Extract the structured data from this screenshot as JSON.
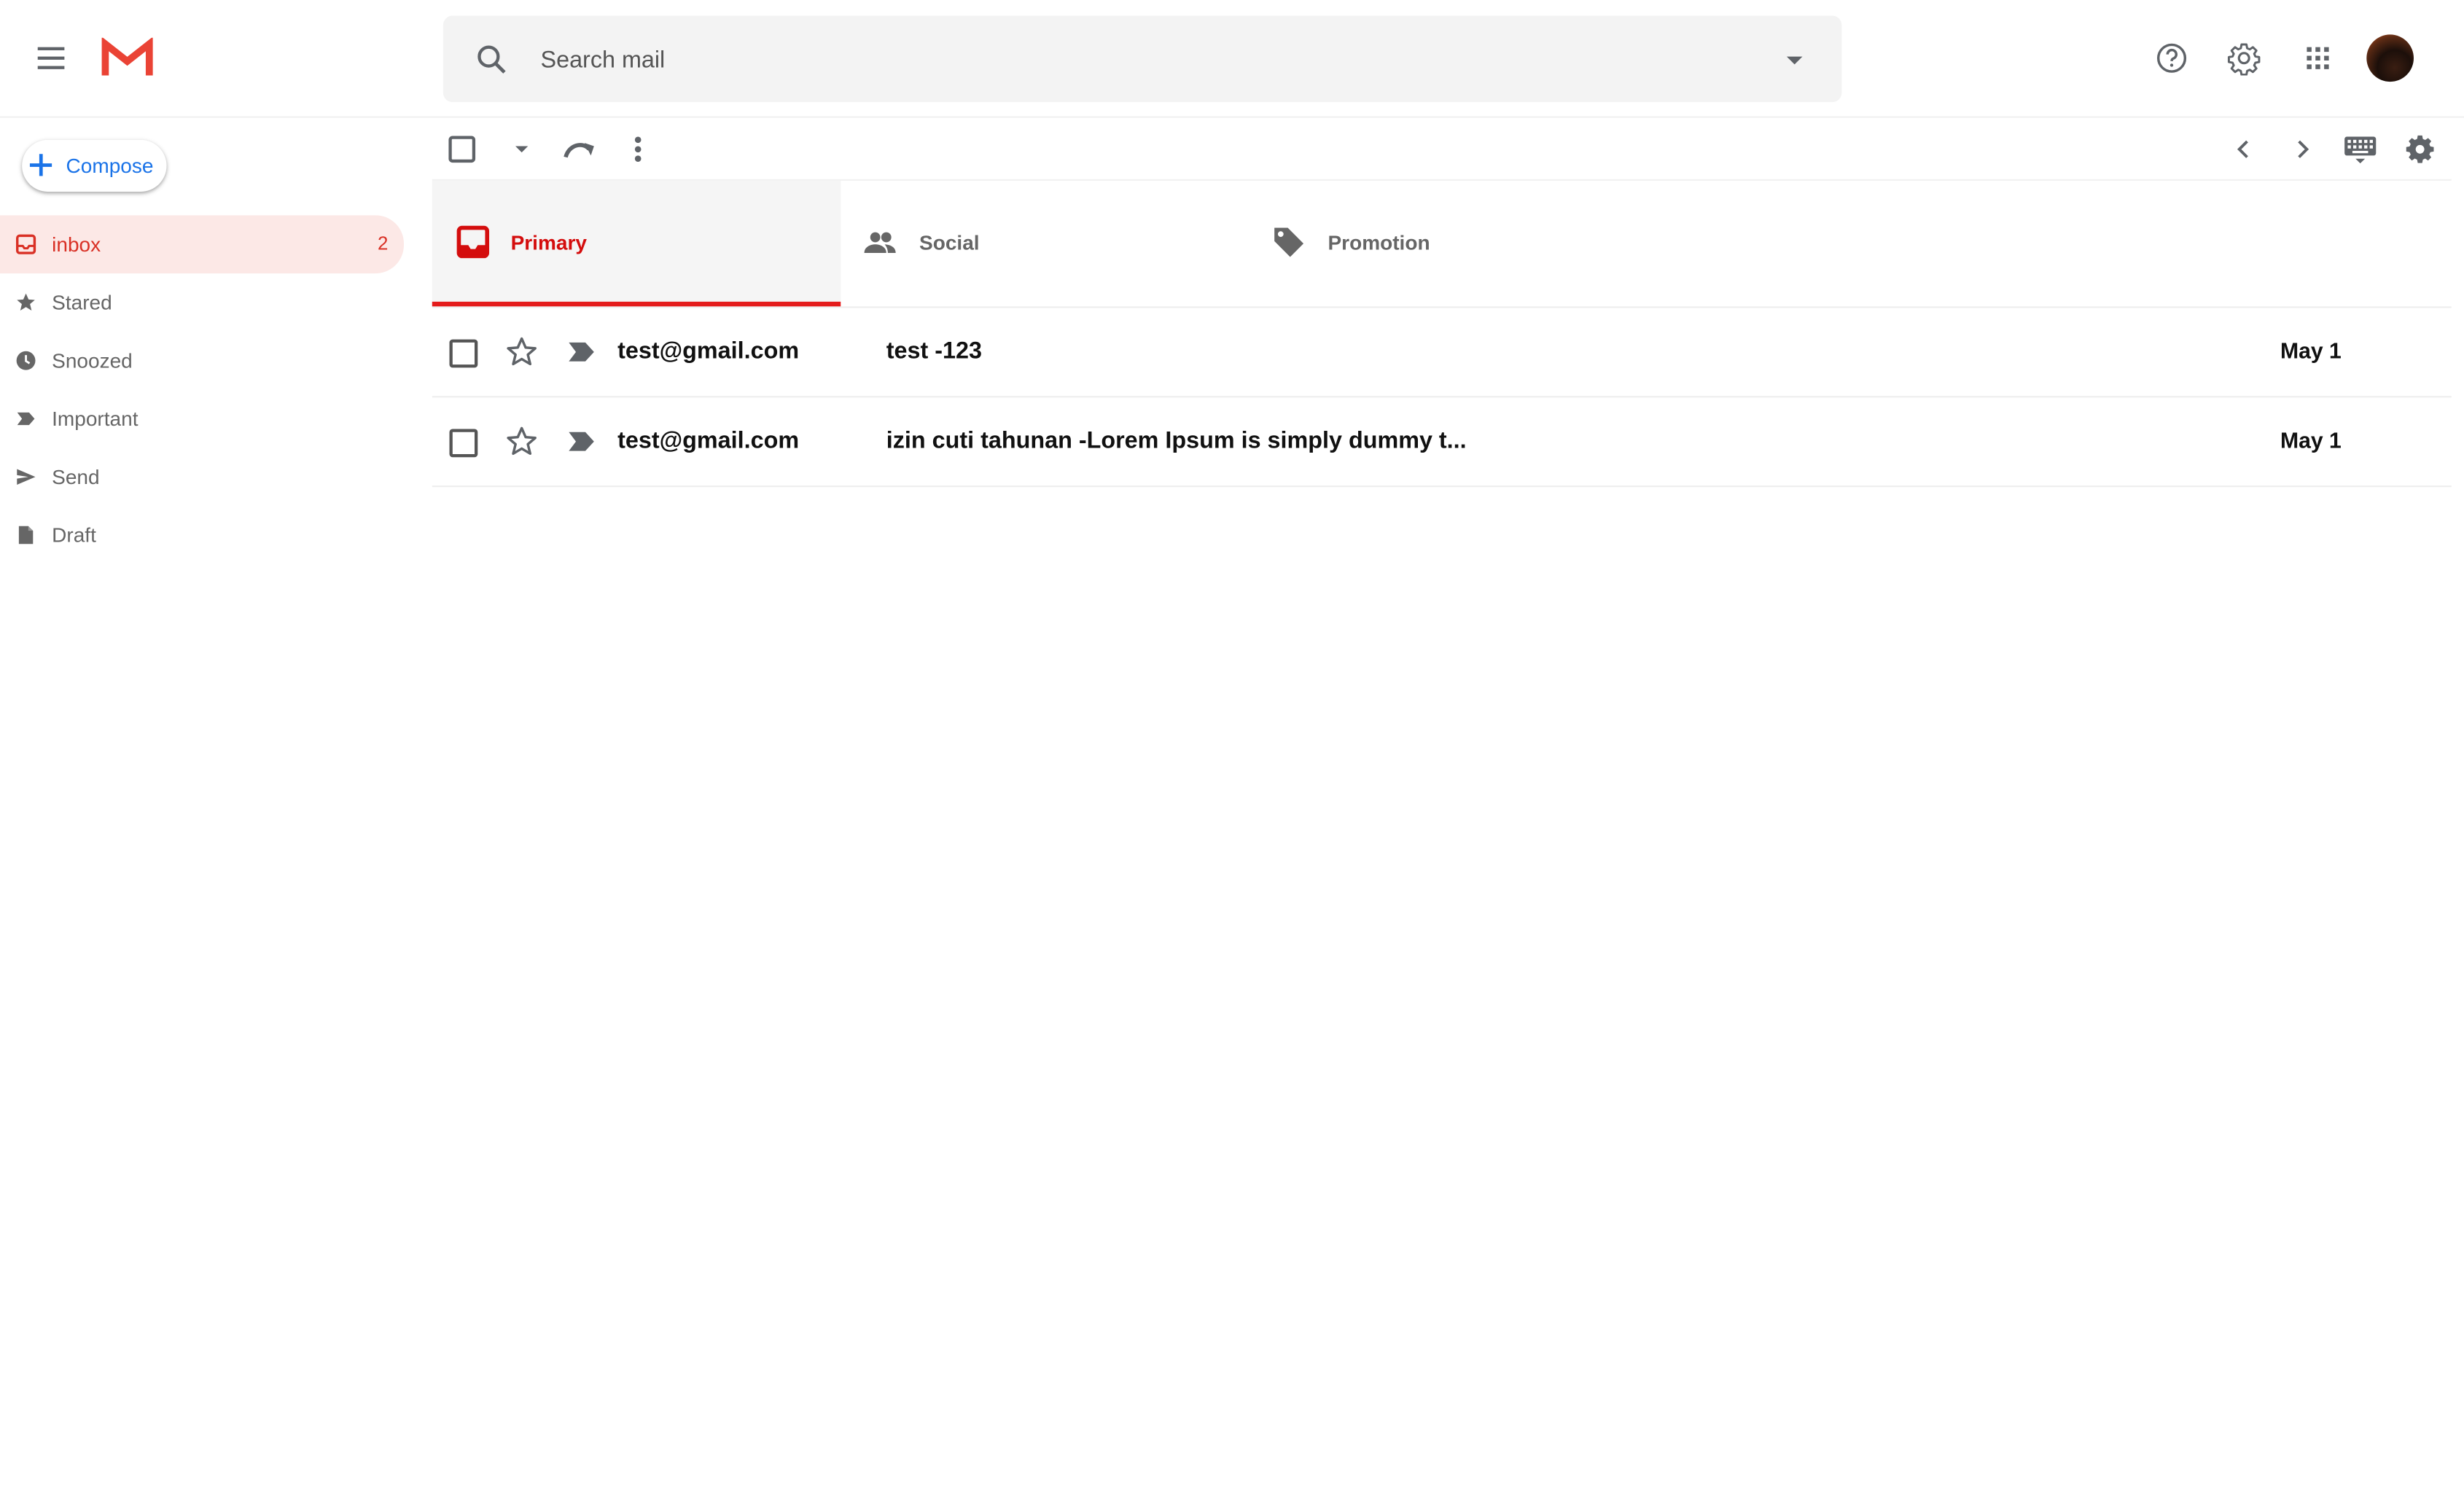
{
  "header": {
    "search_placeholder": "Search mail",
    "icons": [
      "menu-icon",
      "gmail-logo",
      "search-icon",
      "search-options-icon",
      "help-icon",
      "settings-icon",
      "apps-icon",
      "avatar"
    ]
  },
  "sidebar": {
    "compose_label": "Compose",
    "items": [
      {
        "label": "inbox",
        "icon": "inbox-icon",
        "count": "2",
        "active": true
      },
      {
        "label": "Stared",
        "icon": "star-icon"
      },
      {
        "label": "Snoozed",
        "icon": "clock-icon"
      },
      {
        "label": "Important",
        "icon": "important-icon"
      },
      {
        "label": "Send",
        "icon": "send-icon"
      },
      {
        "label": "Draft",
        "icon": "draft-icon"
      }
    ]
  },
  "toolbar": {
    "icons": [
      "select-all-checkbox",
      "select-dropdown-icon",
      "refresh-icon",
      "more-icon",
      "prev-page-icon",
      "next-page-icon",
      "keyboard-icon",
      "settings-icon"
    ]
  },
  "tabs": [
    {
      "label": "Primary",
      "icon": "inbox-icon",
      "active": true
    },
    {
      "label": "Social",
      "icon": "people-icon"
    },
    {
      "label": "Promotion",
      "icon": "tag-icon"
    }
  ],
  "emails": [
    {
      "sender": "test@gmail.com",
      "subject": "test -123",
      "date": "May 1"
    },
    {
      "sender": "test@gmail.com",
      "subject": "izin cuti tahunan -Lorem Ipsum is simply dummy t...",
      "date": "May 1"
    }
  ],
  "colors": {
    "accent": "#d93025",
    "compose_blue": "#1a73e8",
    "active_nav_bg": "#fce8e6",
    "tab_indicator": "#e41c1c",
    "search_bg": "#f3f3f3"
  }
}
